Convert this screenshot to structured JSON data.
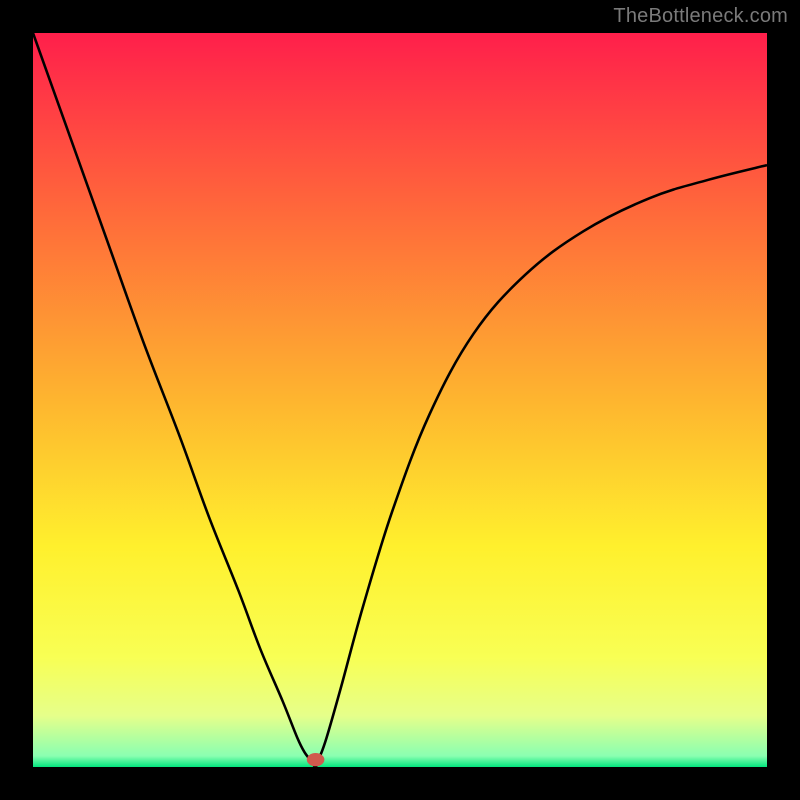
{
  "attribution": "TheBottleneck.com",
  "chart_data": {
    "type": "line",
    "title": "",
    "xlabel": "",
    "ylabel": "",
    "xlim": [
      0,
      100
    ],
    "ylim": [
      0,
      100
    ],
    "grid": false,
    "legend": false,
    "background_gradient": {
      "direction": "vertical",
      "stops": [
        {
          "pos": 0.0,
          "color": "#ff1f4b"
        },
        {
          "pos": 0.25,
          "color": "#ff6b3a"
        },
        {
          "pos": 0.5,
          "color": "#feb52f"
        },
        {
          "pos": 0.7,
          "color": "#fff02d"
        },
        {
          "pos": 0.85,
          "color": "#f8ff54"
        },
        {
          "pos": 0.93,
          "color": "#e6ff8a"
        },
        {
          "pos": 0.985,
          "color": "#8affb1"
        },
        {
          "pos": 1.0,
          "color": "#03e57e"
        }
      ]
    },
    "marker": {
      "x": 38.5,
      "y": 1.0,
      "color": "#d05a4e",
      "rx": 1.2,
      "ry": 0.9
    },
    "series": [
      {
        "name": "bottleneck-curve",
        "color": "#000000",
        "x": [
          0,
          5,
          10,
          15,
          20,
          24,
          28,
          31,
          34,
          36,
          37,
          38,
          38.5,
          39,
          40,
          42,
          45,
          49,
          54,
          60,
          67,
          75,
          84,
          92,
          100
        ],
        "y": [
          100,
          86,
          72,
          58,
          45,
          34,
          24,
          16,
          9,
          4,
          2,
          0.7,
          0,
          1.2,
          4,
          11,
          22,
          35,
          48,
          59,
          67,
          73,
          77.5,
          80,
          82
        ]
      }
    ]
  }
}
